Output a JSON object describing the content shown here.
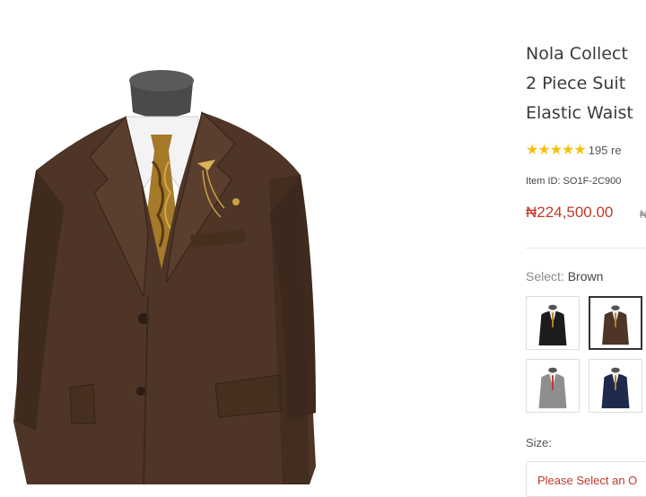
{
  "product": {
    "title_lines": [
      "Nola Collect",
      "2 Piece Suit",
      "Elastic Waist"
    ],
    "stars": "★★★★★",
    "review_count": "195 re",
    "item_id": "Item ID: SO1F-2C900",
    "price": "₦224,500.00",
    "old_price": "₦"
  },
  "select": {
    "label": "Select:",
    "value": "Brown"
  },
  "colors": {
    "swatches": [
      {
        "name": "black",
        "hex": "#1c1c1c"
      },
      {
        "name": "brown",
        "hex": "#4e3527"
      },
      {
        "name": "gray",
        "hex": "#8e8e8e"
      },
      {
        "name": "navy",
        "hex": "#1d2a4d"
      }
    ],
    "price_red": "#c0392b",
    "star_yellow": "#f4c20d"
  },
  "size": {
    "label": "Size:",
    "placeholder": "Please Select an O"
  }
}
